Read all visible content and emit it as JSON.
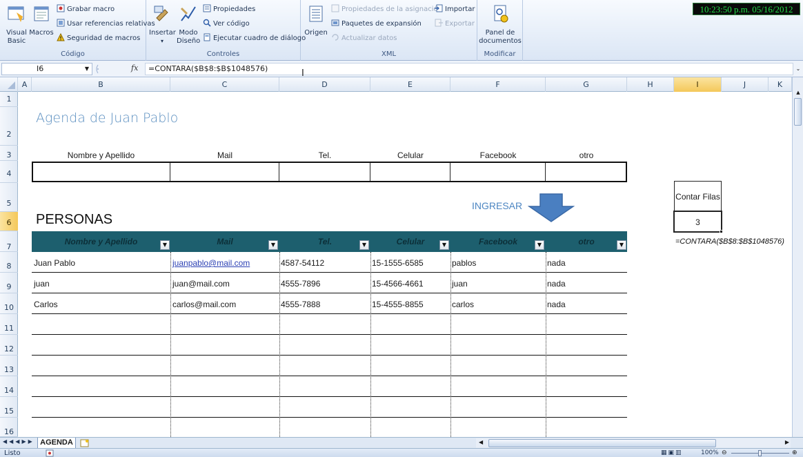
{
  "ribbon": {
    "codigo": {
      "label": "Código",
      "visual_basic": "Visual\nBasic",
      "macros": "Macros",
      "grabar_macro": "Grabar macro",
      "usar_referencias": "Usar referencias relativas",
      "seguridad": "Seguridad de macros"
    },
    "controles": {
      "label": "Controles",
      "insertar": "Insertar",
      "modo_diseno": "Modo\nDiseño",
      "propiedades": "Propiedades",
      "ver_codigo": "Ver código",
      "ejecutar": "Ejecutar cuadro de diálogo"
    },
    "xml": {
      "label": "XML",
      "origen": "Origen",
      "propiedades_asignacion": "Propiedades de la asignación",
      "paquetes": "Paquetes de expansión",
      "actualizar": "Actualizar datos",
      "importar": "Importar",
      "exportar": "Exportar"
    },
    "modificar": {
      "label": "Modificar",
      "panel": "Panel de\ndocumentos"
    },
    "clock": "10:23:50 p.m. 05/16/2012"
  },
  "formula_bar": {
    "name_box": "I6",
    "fx": "fx",
    "formula": "=CONTARA($B$8:$B$1048576)"
  },
  "columns": [
    "A",
    "B",
    "C",
    "D",
    "E",
    "F",
    "G",
    "H",
    "I",
    "J",
    "K"
  ],
  "rows": [
    "1",
    "2",
    "3",
    "4",
    "5",
    "6",
    "7",
    "8",
    "9",
    "10",
    "11",
    "12",
    "13",
    "14",
    "15",
    "16"
  ],
  "selected": {
    "column": "I",
    "row": "6"
  },
  "sheet": {
    "title": "Agenda de Juan Pablo",
    "input_headers": [
      "Nombre y Apellido",
      "Mail",
      "Tel.",
      "Celular",
      "Facebook",
      "otro"
    ],
    "ingresar": "INGRESAR",
    "contar_label": "Contar Filas",
    "contar_value": "3",
    "contar_formula": "=CONTARA($B$8:$B$1048576)",
    "personas": "PERSONAS",
    "table_headers": [
      "Nombre y Apellido",
      "Mail",
      "Tel.",
      "Celular",
      "Facebook",
      "otro"
    ],
    "table_rows": [
      [
        "Juan Pablo",
        "juanpablo@mail.com",
        "4587-54112",
        "15-1555-6585",
        "pablos",
        "nada"
      ],
      [
        "juan",
        "juan@mail.com",
        "4555-7896",
        "15-4566-4661",
        "juan",
        "nada"
      ],
      [
        "Carlos",
        "carlos@mail.com",
        "4555-7888",
        "15-4555-8855",
        "carlos",
        "nada"
      ]
    ]
  },
  "tabs": {
    "active": "AGENDA"
  },
  "status": {
    "ready": "Listo",
    "zoom": "100%"
  },
  "colors": {
    "table_header": "#1d5f6e",
    "title": "#5b8fc0",
    "arrow": "#4a7fc1",
    "clock": "#22e04a"
  }
}
